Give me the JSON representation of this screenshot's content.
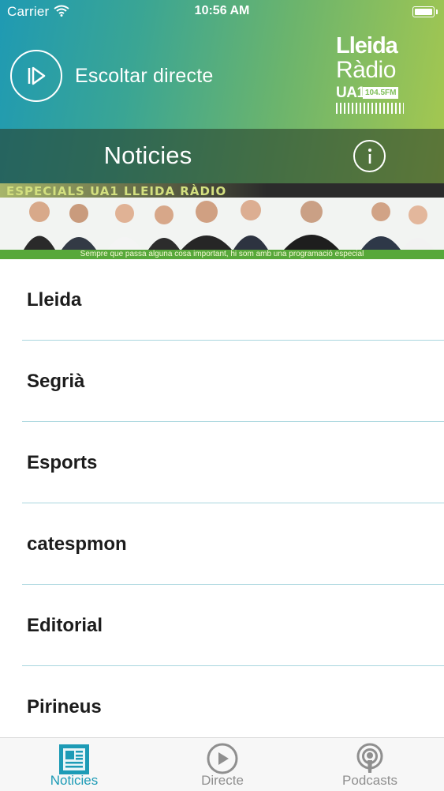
{
  "status_bar": {
    "carrier": "Carrier",
    "time": "10:56 AM"
  },
  "header": {
    "play_label": "Escoltar directe",
    "logo": {
      "line1": "Lleida",
      "line2": "Ràdio",
      "ua": "UA1",
      "fm": "104.5FM"
    }
  },
  "title_bar": {
    "title": "Noticies"
  },
  "banner": {
    "title": "ESPECIALS UA1 LLEIDA RÀDIO",
    "caption": "Sempre que passa alguna cosa important, hi som amb una programació especial"
  },
  "sections": [
    {
      "label": "Lleida"
    },
    {
      "label": "Segrià"
    },
    {
      "label": "Esports"
    },
    {
      "label": "catespmon"
    },
    {
      "label": "Editorial"
    },
    {
      "label": "Pirineus"
    }
  ],
  "tabs": [
    {
      "label": "Noticies",
      "icon": "newspaper-icon",
      "active": true
    },
    {
      "label": "Directe",
      "icon": "play-icon",
      "active": false
    },
    {
      "label": "Podcasts",
      "icon": "podcast-icon",
      "active": false
    }
  ],
  "colors": {
    "accent": "#1d9bb6",
    "separator": "#a9d6de",
    "header_gradient_start": "#1f9ab3",
    "header_gradient_end": "#a6c84f",
    "banner_green": "#57a83a"
  }
}
